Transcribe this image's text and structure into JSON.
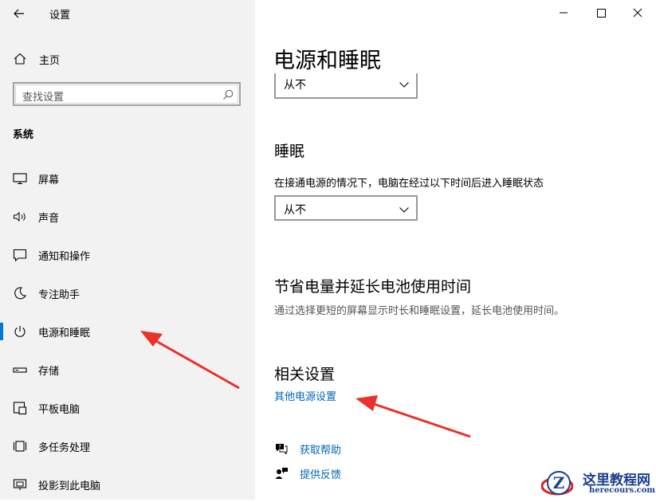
{
  "app": {
    "title": "设置"
  },
  "sidebar": {
    "home_label": "主页",
    "search_placeholder": "查找设置",
    "section_label": "系统",
    "items": [
      {
        "label": "屏幕",
        "icon": "monitor-icon",
        "selected": false
      },
      {
        "label": "声音",
        "icon": "speaker-icon",
        "selected": false
      },
      {
        "label": "通知和操作",
        "icon": "notification-icon",
        "selected": false
      },
      {
        "label": "专注助手",
        "icon": "moon-icon",
        "selected": false
      },
      {
        "label": "电源和睡眠",
        "icon": "power-icon",
        "selected": true
      },
      {
        "label": "存储",
        "icon": "storage-icon",
        "selected": false
      },
      {
        "label": "平板电脑",
        "icon": "tablet-icon",
        "selected": false
      },
      {
        "label": "多任务处理",
        "icon": "multitask-icon",
        "selected": false
      },
      {
        "label": "投影到此电脑",
        "icon": "project-icon",
        "selected": false
      }
    ]
  },
  "main": {
    "title": "电源和睡眠",
    "screen_dropdown_value": "从不",
    "sleep": {
      "heading": "睡眠",
      "description": "在接通电源的情况下，电脑在经过以下时间后进入睡眠状态",
      "dropdown_value": "从不"
    },
    "battery": {
      "heading": "节省电量并延长电池使用时间",
      "description": "通过选择更短的屏幕显示时长和睡眠设置，延长电池使用时间。"
    },
    "related": {
      "heading": "相关设置",
      "link": "其他电源设置"
    },
    "help": {
      "label": "获取帮助",
      "icon": "help-chat-icon"
    },
    "feedback": {
      "label": "提供反馈",
      "icon": "feedback-icon"
    }
  },
  "watermark": {
    "title": "这里教程网",
    "url": "herecours.com",
    "badge": "Z"
  },
  "colors": {
    "accent": "#0078d7",
    "link": "#0067b8",
    "sidebar_bg": "#f2f2f2",
    "annotation_arrow": "#e8322a"
  }
}
